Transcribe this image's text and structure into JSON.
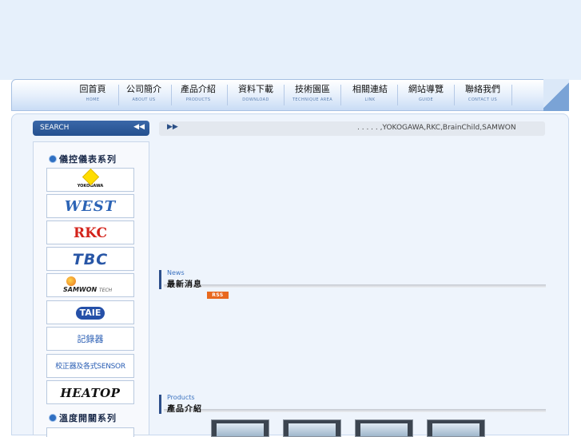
{
  "nav": {
    "items": [
      {
        "zh": "回首頁",
        "en": "HOME"
      },
      {
        "zh": "公司簡介",
        "en": "ABOUT US"
      },
      {
        "zh": "產品介紹",
        "en": "PRODUCTS"
      },
      {
        "zh": "資料下載",
        "en": "DOWNLOAD"
      },
      {
        "zh": "技術園區",
        "en": "TECHNIQUE AREA"
      },
      {
        "zh": "相關連結",
        "en": "LINK"
      },
      {
        "zh": "網站導覽",
        "en": "GUIDE"
      },
      {
        "zh": "聯絡我們",
        "en": "CONTACT US"
      }
    ]
  },
  "search": {
    "label": "SEARCH",
    "chevron": "◀◀"
  },
  "sidebar": {
    "category1": "儀控儀表系列",
    "category2": "溫度開關系列",
    "brands": {
      "yokogawa": "YOKOGAWA",
      "west": "WEST",
      "rkc": "RKC",
      "tbc": "TBC",
      "samwon": "SAMWON",
      "samwon_sub": "TECH",
      "taie": "TAIE",
      "recorder": "記錄器",
      "calibrator": "校正器及各式SENSOR",
      "heatop": "HEATOP"
    }
  },
  "ticker": {
    "arrow": "▶▶",
    "text": ". . . . . ,YOKOGAWA,RKC,BrainChild,SAMWON"
  },
  "news": {
    "en": "News",
    "zh": "最新消息",
    "rss": "RSS"
  },
  "products": {
    "en": "Products",
    "zh": "產品介紹"
  }
}
